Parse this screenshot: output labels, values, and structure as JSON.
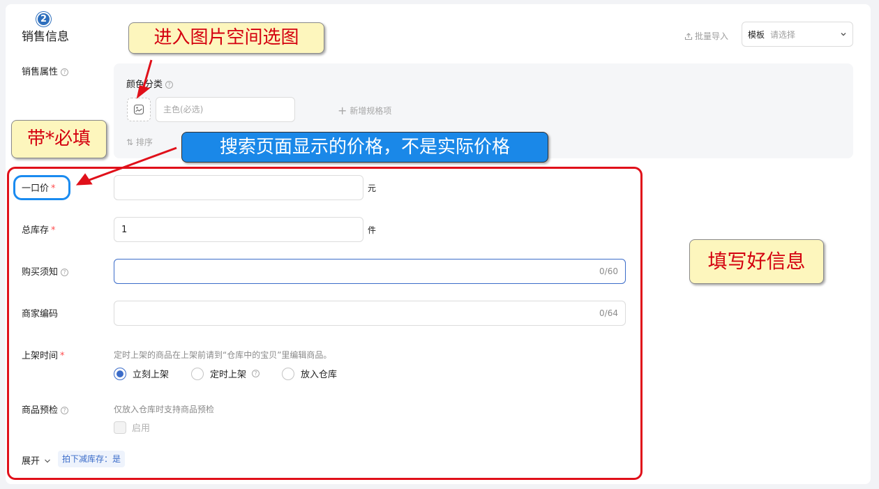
{
  "section": {
    "step_number": "2",
    "title": "销售信息",
    "bulk_import_label": "批量导入",
    "template_prefix": "模板",
    "template_placeholder": "请选择"
  },
  "sales_attributes": {
    "label": "销售属性",
    "color_category_label": "颜色分类",
    "main_color_placeholder": "主色(必选)",
    "add_spec_label": "新增规格项",
    "sort_label": "排序"
  },
  "fields": {
    "price": {
      "label": "一口价",
      "required_mark": "*",
      "value": "",
      "unit": "元"
    },
    "stock": {
      "label": "总库存",
      "required_mark": "*",
      "value": "1",
      "unit": "件"
    },
    "purchase_notice": {
      "label": "购买须知",
      "value": "",
      "counter": "0/60"
    },
    "merchant_code": {
      "label": "商家编码",
      "value": "",
      "counter": "0/64"
    },
    "listing_time": {
      "label": "上架时间",
      "required_mark": "*",
      "hint": "定时上架的商品在上架前请到“仓库中的宝贝”里编辑商品。",
      "options": [
        "立刻上架",
        "定时上架",
        "放入仓库"
      ],
      "selected": "立刻上架"
    },
    "pre_inspection": {
      "label": "商品预检",
      "hint": "仅放入仓库时支持商品预检",
      "checkbox_label": "启用"
    }
  },
  "footer": {
    "expand_label": "展开",
    "reduce_stock_tag": "拍下减库存：是"
  },
  "annotations": {
    "enter_image_space": "进入图片空间选图",
    "required_note": "带*必填",
    "price_note": "搜索页面显示的价格，不是实际价格",
    "fill_info": "填写好信息"
  },
  "colors": {
    "accent": "#3b6cc9",
    "required": "#ff4d4f",
    "annotation_red": "#e0101a",
    "annotation_blue": "#1a88e8",
    "callout_yellow": "#fdf6bd"
  }
}
